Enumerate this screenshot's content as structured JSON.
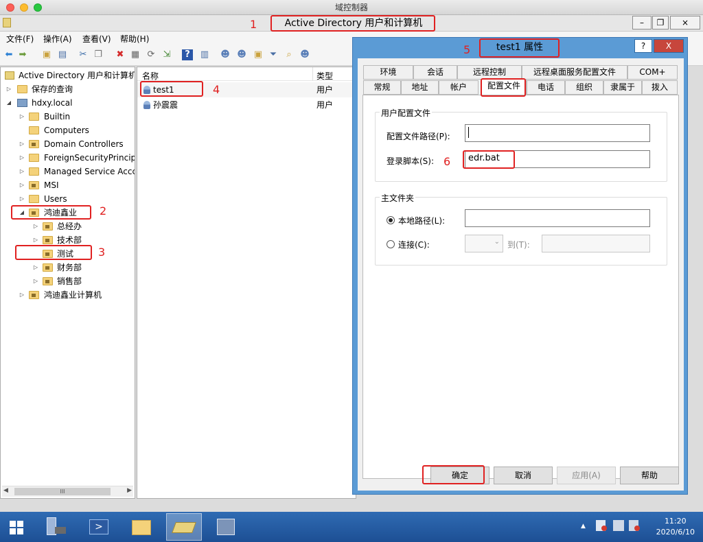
{
  "mac_window": {
    "title": "域控制器"
  },
  "app": {
    "title": "Active Directory 用户和计算机",
    "window_buttons": [
      "–",
      "❐",
      "×"
    ]
  },
  "menu": [
    "文件(F)",
    "操作(A)",
    "查看(V)",
    "帮助(H)"
  ],
  "tree": {
    "root": "Active Directory 用户和计算机",
    "items": [
      {
        "label": "保存的查询"
      },
      {
        "label": "hdxy.local"
      },
      {
        "label": "Builtin"
      },
      {
        "label": "Computers"
      },
      {
        "label": "Domain Controllers"
      },
      {
        "label": "ForeignSecurityPrincipa"
      },
      {
        "label": "Managed Service Accc"
      },
      {
        "label": "MSI"
      },
      {
        "label": "Users"
      },
      {
        "label": "鸿迪鑫业"
      },
      {
        "label": "总经办"
      },
      {
        "label": "技术部"
      },
      {
        "label": "测试"
      },
      {
        "label": "财务部"
      },
      {
        "label": "销售部"
      },
      {
        "label": "鸿迪鑫业计算机"
      }
    ],
    "scroll_mid": "III"
  },
  "list": {
    "columns": [
      "名称",
      "类型"
    ],
    "rows": [
      {
        "name": "test1",
        "type": "用户"
      },
      {
        "name": "孙震震",
        "type": "用户"
      }
    ]
  },
  "dialog": {
    "title": "test1 属性",
    "help_btn": "?",
    "close_btn": "X",
    "tabs_row1": [
      "环境",
      "会话",
      "远程控制",
      "远程桌面服务配置文件",
      "COM+"
    ],
    "tabs_row2": [
      "常规",
      "地址",
      "帐户",
      "配置文件",
      "电话",
      "组织",
      "隶属于",
      "拨入"
    ],
    "active_tab": "配置文件",
    "profile_group": "用户配置文件",
    "profile_path_label": "配置文件路径(P):",
    "profile_path_value": "",
    "logon_script_label": "登录脚本(S):",
    "logon_script_value": "edr.bat",
    "home_group": "主文件夹",
    "local_path_label": "本地路径(L):",
    "local_path_value": "",
    "connect_label": "连接(C):",
    "to_label": "到(T):",
    "buttons": {
      "ok": "确定",
      "cancel": "取消",
      "apply": "应用(A)",
      "help": "帮助"
    }
  },
  "annotations": [
    "1",
    "2",
    "3",
    "4",
    "5",
    "6"
  ],
  "taskbar": {
    "time": "11:20",
    "date": "2020/6/10"
  },
  "colors": {
    "annotation_red": "#e02020",
    "dialog_frame": "#5b9bd5",
    "taskbar": "#1d4f94"
  }
}
